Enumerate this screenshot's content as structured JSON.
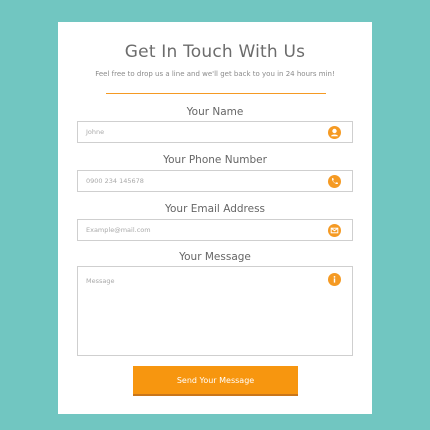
{
  "form": {
    "title": "Get In Touch With Us",
    "subtitle": "Feel free to drop us a line and we'll get back to you in 24 hours min!",
    "name_label": "Your Name",
    "name_placeholder": "Johne",
    "phone_label": "Your Phone Number",
    "phone_placeholder": "0900 234 145678",
    "email_label": "Your Email Address",
    "email_placeholder": "Example@mail.com",
    "message_label": "Your Message",
    "message_placeholder": "Message",
    "submit_label": "Send Your Message"
  },
  "icons": {
    "name": "user-icon",
    "phone": "phone-icon",
    "email": "envelope-icon",
    "message": "info-icon"
  },
  "colors": {
    "background": "#71c6c1",
    "accent": "#f59a23",
    "card": "#ffffff"
  }
}
